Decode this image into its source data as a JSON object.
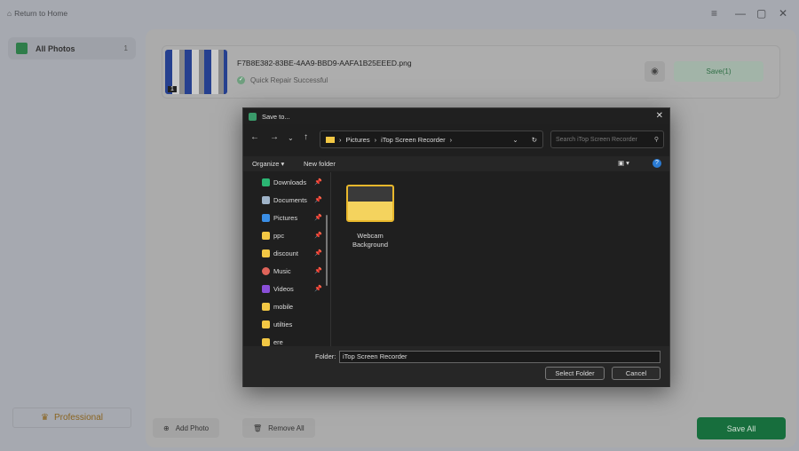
{
  "header": {
    "return_home": "Return to Home"
  },
  "sidebar": {
    "items": [
      {
        "label": "All Photos",
        "count": "1"
      }
    ],
    "professional": "Professional"
  },
  "photo": {
    "filename": "F7B8E382-83BE-4AA9-BBD9-AAFA1B25EEED.png",
    "status": "Quick Repair Successful",
    "save_label": "Save(1)",
    "thumb_badge": "1"
  },
  "footer": {
    "add_photo": "Add Photo",
    "remove_all": "Remove All",
    "save_all": "Save All"
  },
  "dialog": {
    "title": "Save to...",
    "breadcrumb": [
      "Pictures",
      "iTop Screen Recorder"
    ],
    "search_placeholder": "Search iTop Screen Recorder",
    "organize": "Organize",
    "new_folder": "New folder",
    "nav_items": [
      {
        "label": "Downloads",
        "pinned": true,
        "color": "#2bb673"
      },
      {
        "label": "Documents",
        "pinned": true,
        "color": "#9fb3c8"
      },
      {
        "label": "Pictures",
        "pinned": true,
        "color": "#3a8ee6"
      },
      {
        "label": "ppc",
        "pinned": true,
        "color": "#f2c744"
      },
      {
        "label": "discount",
        "pinned": true,
        "color": "#f2c744"
      },
      {
        "label": "Music",
        "pinned": true,
        "color": "#e0645a"
      },
      {
        "label": "Videos",
        "pinned": true,
        "color": "#8a4fd8"
      },
      {
        "label": "mobile",
        "pinned": false,
        "color": "#f2c744"
      },
      {
        "label": "utilties",
        "pinned": false,
        "color": "#f2c744"
      },
      {
        "label": "ere",
        "pinned": false,
        "color": "#f2c744"
      }
    ],
    "folder_item": "Webcam Background",
    "folder_label": "Folder:",
    "folder_value": "iTop Screen Recorder",
    "select_folder": "Select Folder",
    "cancel": "Cancel"
  }
}
